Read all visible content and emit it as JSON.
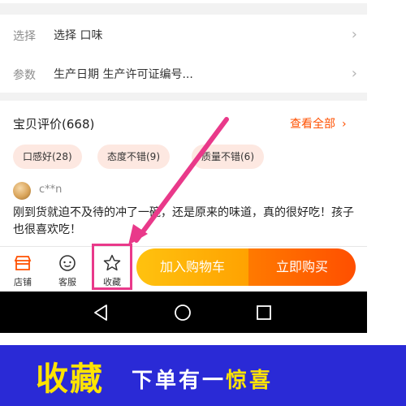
{
  "detail_rows": [
    {
      "label": "选择",
      "value": "选择 口味"
    },
    {
      "label": "参数",
      "value": "生产日期 生产许可证编号..."
    }
  ],
  "reviews": {
    "title": "宝贝评价(668)",
    "view_all": "查看全部",
    "chips": [
      "口感好(28)",
      "态度不错(9)",
      "质量不错(6)"
    ],
    "review": {
      "username": "c**n",
      "text": "刚到货就迫不及待的冲了一碗，还是原来的味道，真的很好吃！孩子也很喜欢吃！"
    }
  },
  "bottom_bar": {
    "items": [
      {
        "label": "店铺",
        "icon": "store-icon"
      },
      {
        "label": "客服",
        "icon": "chat-icon"
      },
      {
        "label": "收藏",
        "icon": "star-icon"
      }
    ],
    "add_to_cart": "加入购物车",
    "buy_now": "立即购买"
  },
  "banner": {
    "big": "收藏",
    "small_pre": "下单有一",
    "small_highlight": "惊喜"
  },
  "colors": {
    "accent": "#ff5000",
    "annotation": "#e9398a",
    "banner_bg": "#2a2ad6",
    "banner_yellow": "#ffe400"
  }
}
